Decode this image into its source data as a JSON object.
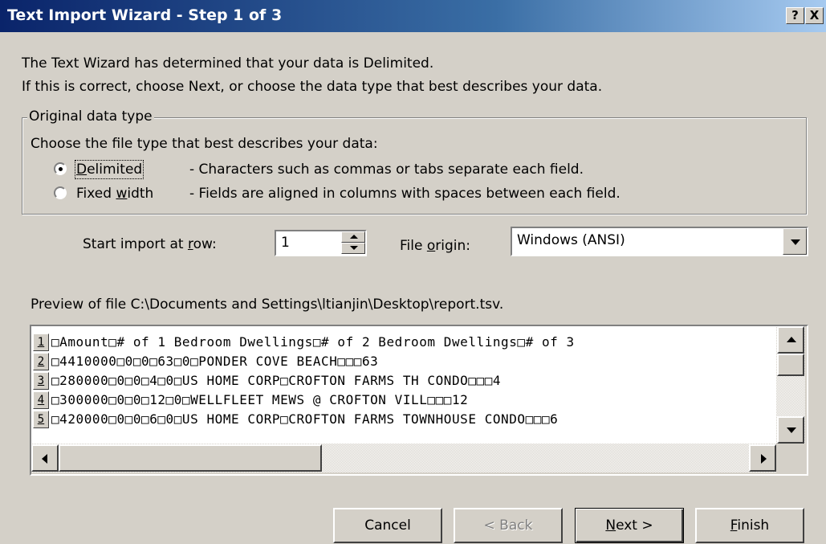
{
  "window": {
    "title": "Text Import Wizard - Step 1 of 3",
    "help_label": "?",
    "close_label": "X"
  },
  "intro": {
    "line1": "The Text Wizard has determined that your data is Delimited.",
    "line2": "If this is correct, choose Next, or choose the data type that best describes your data."
  },
  "original_data_type": {
    "legend": "Original data type",
    "prompt": "Choose the file type that best describes your data:",
    "options": [
      {
        "label_pre": "",
        "label_key": "D",
        "label_post": "elimited",
        "description": "- Characters such as commas or tabs separate each field.",
        "selected": true
      },
      {
        "label_pre": "Fixed ",
        "label_key": "w",
        "label_post": "idth",
        "description": "- Fields are aligned in columns with spaces between each field.",
        "selected": false
      }
    ]
  },
  "start_row": {
    "label_pre": "Start import at ",
    "label_key": "r",
    "label_post": "ow:",
    "value": "1"
  },
  "file_origin": {
    "label_pre": "File ",
    "label_key": "o",
    "label_post": "rigin:",
    "value": "Windows (ANSI)"
  },
  "preview": {
    "label": "Preview of file C:\\Documents and Settings\\ltianjin\\Desktop\\report.tsv.",
    "rows": [
      {
        "num": "1",
        "text": "□Amount□# of 1 Bedroom Dwellings□# of 2 Bedroom Dwellings□# of 3"
      },
      {
        "num": "2",
        "text": "□4410000□0□0□63□0□PONDER COVE BEACH□□□63"
      },
      {
        "num": "3",
        "text": "□280000□0□0□4□0□US HOME CORP□CROFTON FARMS TH CONDO□□□4"
      },
      {
        "num": "4",
        "text": "□300000□0□0□12□0□WELLFLEET MEWS @ CROFTON VILL□□□12"
      },
      {
        "num": "5",
        "text": "□420000□0□0□6□0□US HOME CORP□CROFTON FARMS TOWNHOUSE CONDO□□□6"
      }
    ]
  },
  "buttons": {
    "cancel": "Cancel",
    "back": "< Back",
    "next_key": "N",
    "next_rest": "ext >",
    "finish_key": "F",
    "finish_rest": "inish"
  }
}
